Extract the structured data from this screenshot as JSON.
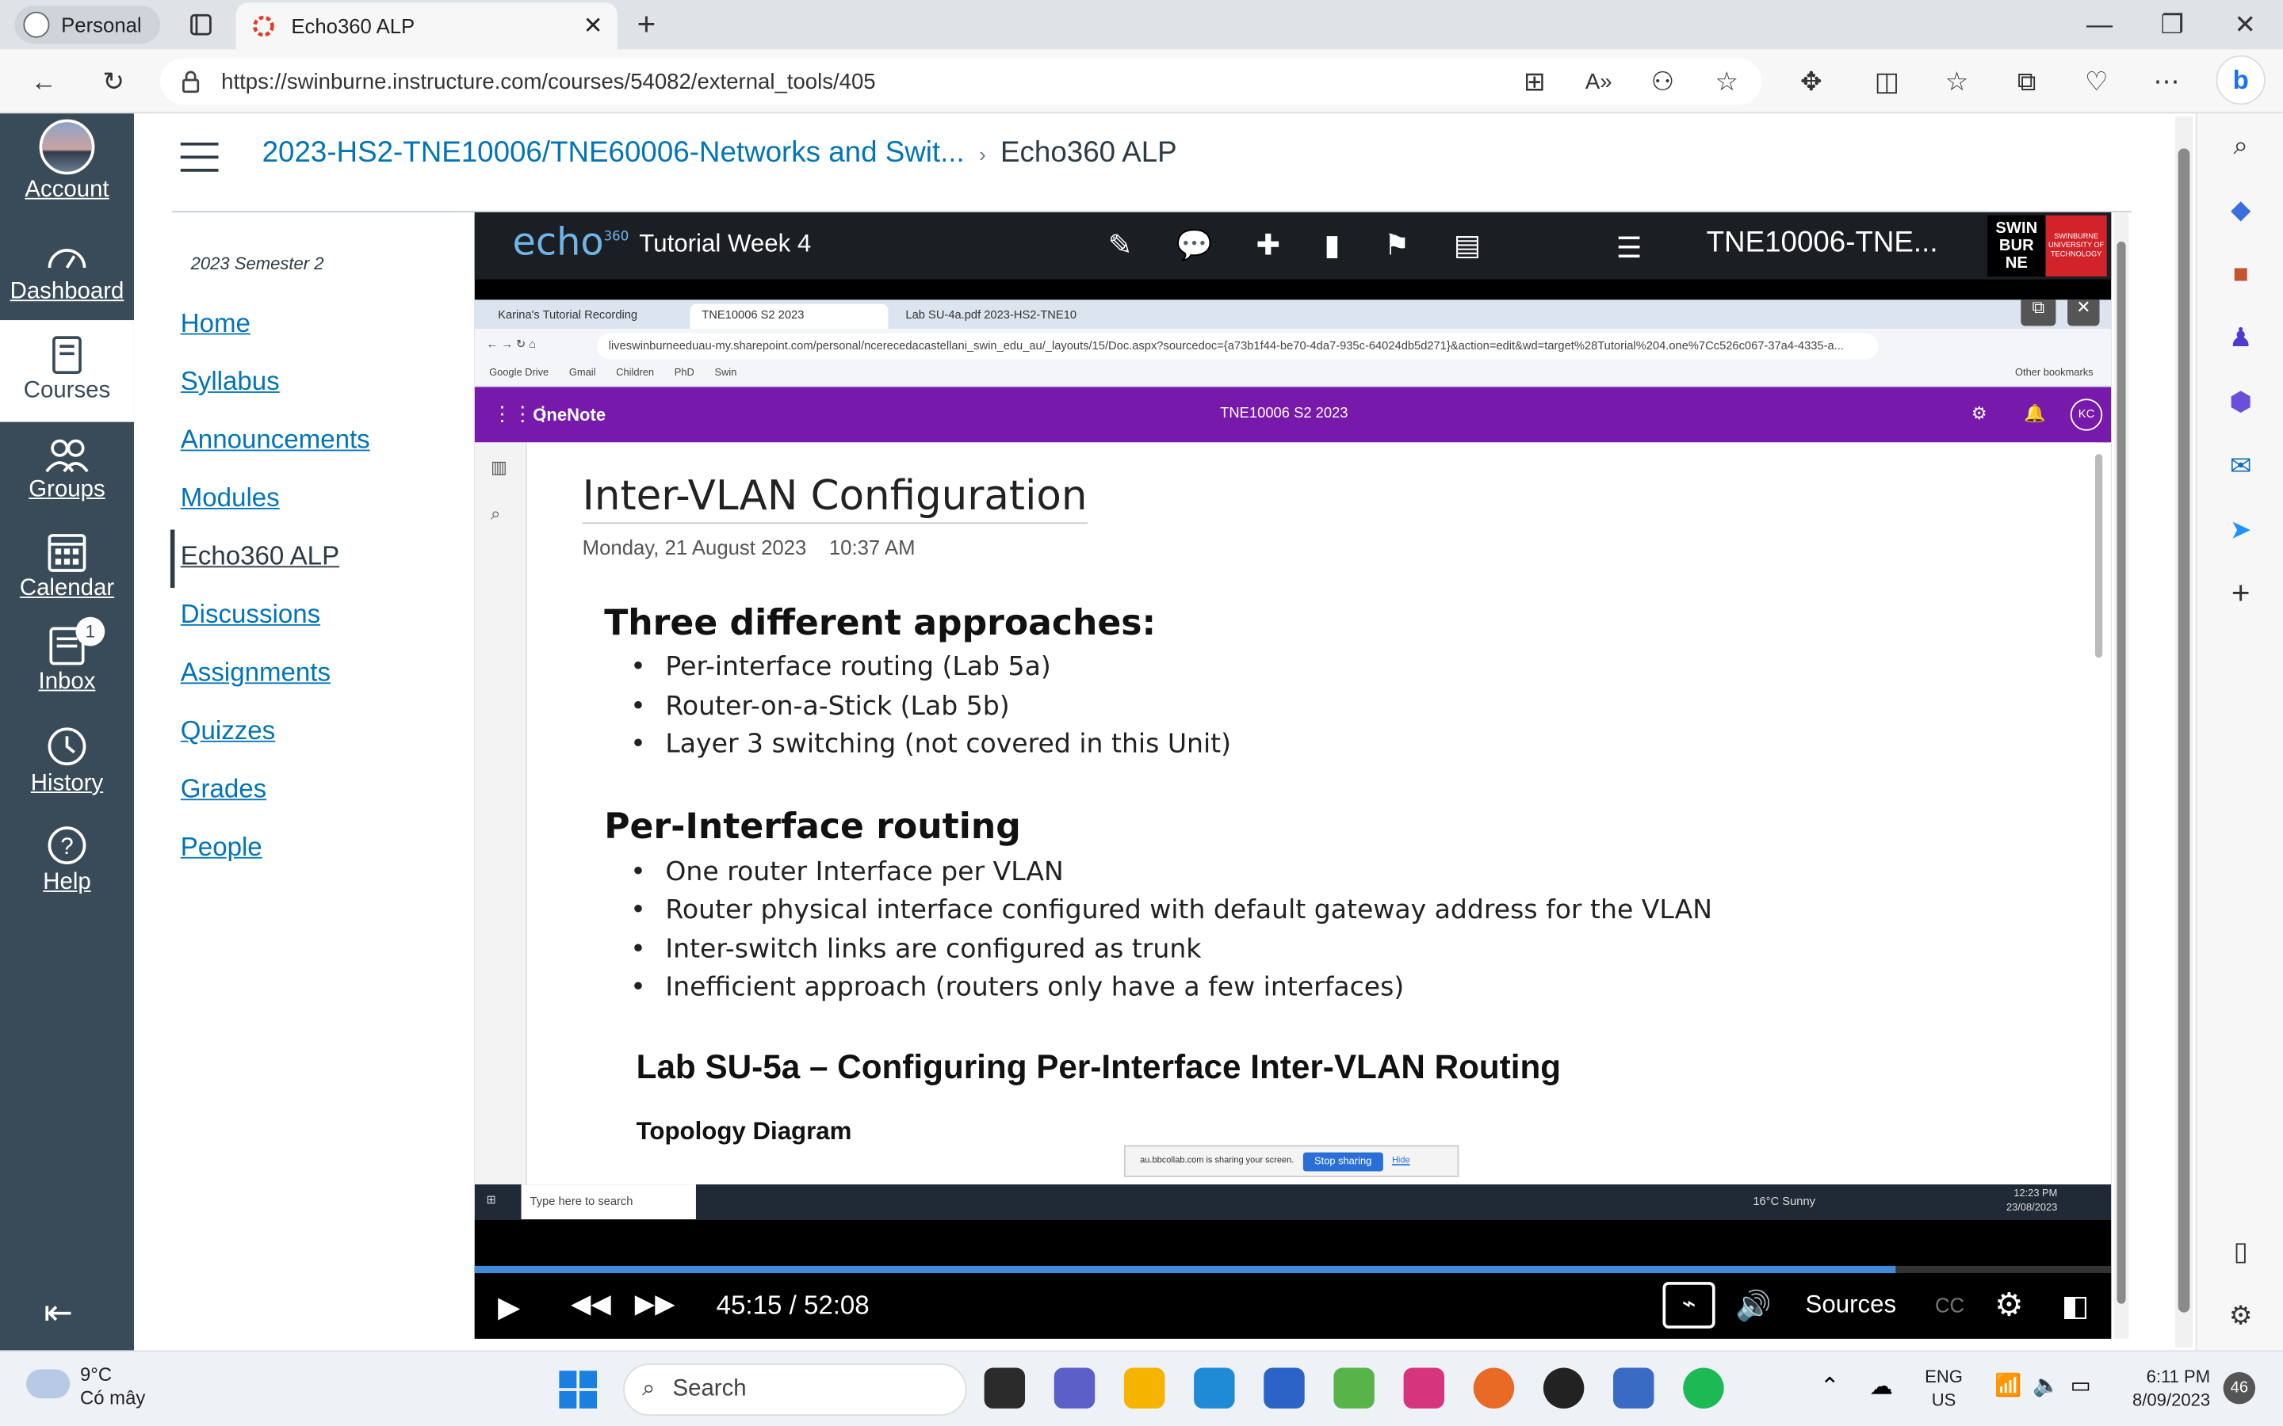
{
  "browser": {
    "profile_label": "Personal",
    "tab_title": "Echo360 ALP",
    "url": "https://swinburne.instructure.com/courses/54082/external_tools/405"
  },
  "global_nav": {
    "items": [
      {
        "label": "Account"
      },
      {
        "label": "Dashboard"
      },
      {
        "label": "Courses"
      },
      {
        "label": "Groups"
      },
      {
        "label": "Calendar"
      },
      {
        "label": "Inbox",
        "badge": "1"
      },
      {
        "label": "History"
      },
      {
        "label": "Help"
      }
    ]
  },
  "breadcrumb": {
    "course": "2023-HS2-TNE10006/TNE60006-Networks and Swit...",
    "current": "Echo360 ALP"
  },
  "course_nav": {
    "term": "2023 Semester 2",
    "items": [
      "Home",
      "Syllabus",
      "Announcements",
      "Modules",
      "Echo360 ALP",
      "Discussions",
      "Assignments",
      "Quizzes",
      "Grades",
      "People"
    ]
  },
  "player": {
    "logo": "echo",
    "logo_sup": "360",
    "title": "Tutorial Week 4",
    "course_code": "TNE10006-TNE...",
    "inst_logo": "SWIN BUR NE",
    "inst_logo_sub": "SWINBURNE UNIVERSITY OF TECHNOLOGY",
    "time": "45:15 / 52:08",
    "progress": 0.868,
    "sources_label": "Sources",
    "cc_label": "CC"
  },
  "recording": {
    "tabs": [
      "Karina's Tutorial Recording",
      "TNE10006 S2 2023",
      "Lab SU-4a.pdf 2023-HS2-TNE10"
    ],
    "url": "liveswinburneeduau-my.sharepoint.com/personal/ncerecedacastellani_swin_edu_au/_layouts/15/Doc.aspx?sourcedoc={a73b1f44-be70-4da7-935c-64024db5d271}&action=edit&wd=target%28Tutorial%204.one%7Cc526c067-37a4-4335-a...",
    "bookmarks": [
      "Google Drive",
      "Gmail",
      "Children",
      "PhD",
      "Swin"
    ],
    "other_bookmarks": "Other bookmarks",
    "app_name": "OneNote",
    "notebook": "TNE10006 S2 2023",
    "user_initials": "KC",
    "page_title": "Inter-VLAN Configuration",
    "page_date": "Monday, 21 August 2023",
    "page_time": "10:37 AM",
    "heading1": "Three different approaches:",
    "bullets1": [
      "Per-interface routing (Lab 5a)",
      "Router-on-a-Stick (Lab 5b)",
      "Layer 3 switching (not covered in this Unit)"
    ],
    "heading2": "Per-Interface routing",
    "bullets2": [
      "One router Interface per VLAN",
      "Router physical interface configured with default gateway address for the VLAN",
      "Inter-switch links are configured as trunk",
      "Inefficient approach (routers only have a few interfaces)"
    ],
    "lab_title": "Lab SU-5a – Configuring Per-Interface Inter-VLAN Routing",
    "topology": "Topology Diagram",
    "share_text": "au.bbcollab.com is sharing your screen.",
    "share_stop": "Stop sharing",
    "share_hide": "Hide",
    "taskbar_search": "Type here to search",
    "taskbar_weather": "16°C  Sunny",
    "taskbar_time": "12:23 PM",
    "taskbar_date": "23/08/2023"
  },
  "taskbar": {
    "temp": "9°C",
    "condition": "Có mây",
    "search_placeholder": "Search",
    "lang_top": "ENG",
    "lang_bottom": "US",
    "time": "6:11 PM",
    "date": "8/09/2023",
    "notifications": "46"
  },
  "colors": {
    "canvas_nav": "#394b58",
    "link": "#0374b5",
    "onenote": "#7719aa",
    "progress": "#3d8bd9"
  }
}
